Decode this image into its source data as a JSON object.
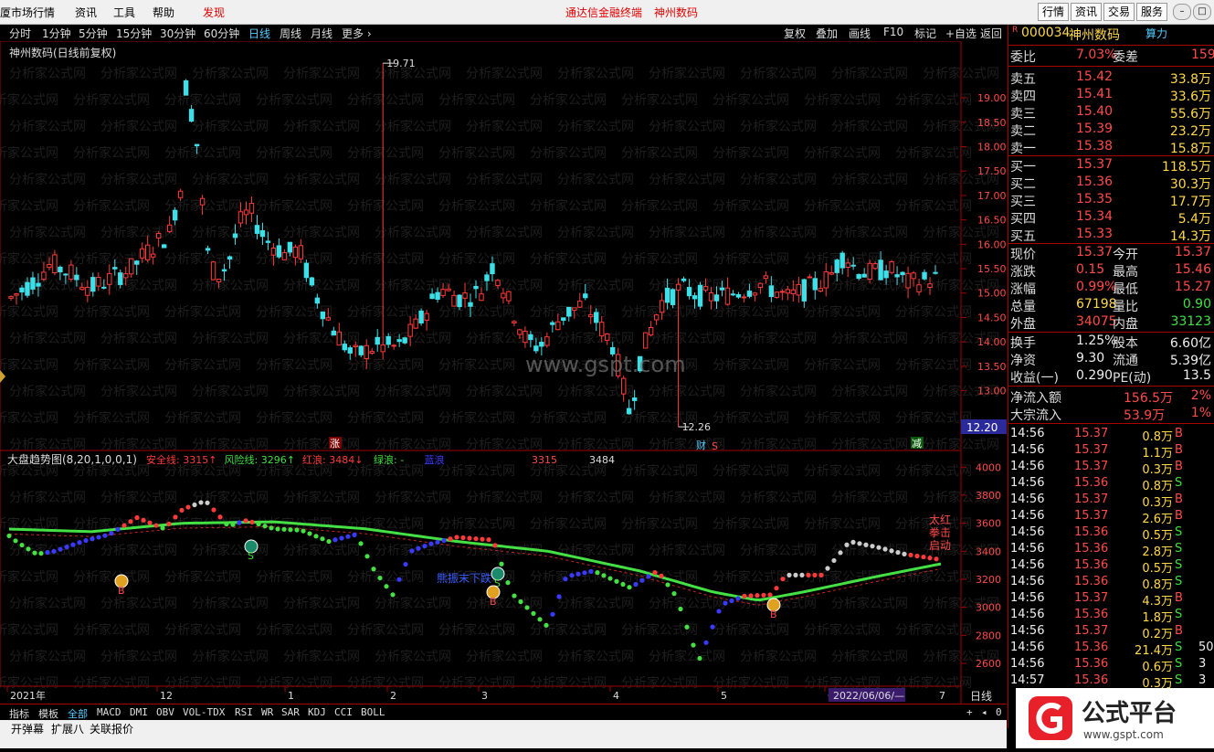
{
  "menu": {
    "items": [
      "厦市场行情",
      "资讯",
      "工具",
      "帮助"
    ],
    "discover": "发现",
    "center_title": "通达信金融终端",
    "center_stock": "神州数码",
    "right_buttons": [
      "行情",
      "资讯",
      "交易",
      "服务"
    ]
  },
  "timeframes": [
    "分时",
    "1分钟",
    "5分钟",
    "15分钟",
    "30分钟",
    "60分钟",
    "日线",
    "周线",
    "月线",
    "更多 ›"
  ],
  "active_timeframe": "日线",
  "chart_tools": [
    "复权",
    "叠加",
    "画线",
    "F10",
    "标记",
    "+自选",
    "返回"
  ],
  "main_chart": {
    "title": "神州数码(日线前复权)",
    "high_label": "19.71",
    "low_label": "12.26",
    "current_price_tag": "12.20",
    "y_ticks": [
      19.0,
      18.5,
      18.0,
      17.5,
      17.0,
      16.5,
      16.0,
      15.5,
      15.0,
      14.5,
      14.0,
      13.5,
      13.0
    ],
    "watermark": "www.gspt.com",
    "bg_watermark": "分析家公式网",
    "markers": {
      "zhang": "涨",
      "cai": "财",
      "s": "S",
      "jian": "减"
    },
    "colors": {
      "up": "#ff3a3a",
      "down": "#3de0e8",
      "axis": "#a00000"
    }
  },
  "indicator": {
    "title": "大盘趋势图(8,20,1,0,0,1)",
    "legend": [
      {
        "label": "安全线: 3315",
        "arrow": "↑",
        "color": "#ff3a3a"
      },
      {
        "label": "风险线: 3296",
        "arrow": "↑",
        "color": "#3fe03f"
      },
      {
        "label": "红浪: 3484",
        "arrow": "↓",
        "color": "#ff3a3a"
      },
      {
        "label": "绿浪: -",
        "arrow": "",
        "color": "#3fe03f"
      },
      {
        "label": "蓝浪",
        "arrow": "",
        "color": "#3a3aff"
      }
    ],
    "extra_values": [
      "3315",
      "3484"
    ],
    "y_ticks": [
      4000,
      3800,
      3600,
      3400,
      3200,
      3000,
      2800,
      2600
    ],
    "note": "熊振末下跌",
    "right_text": [
      "太红",
      "拳击",
      "启动"
    ],
    "signals": {
      "b": "B",
      "s": "S"
    }
  },
  "x_axis": {
    "labels": [
      "2021年",
      "12",
      "1",
      "2",
      "3",
      "4",
      "5",
      "6"
    ],
    "date_label": "2022/06/06/—",
    "last_label": "7",
    "period": "日线"
  },
  "bottom_tabs": [
    "指标",
    "模板",
    "全部",
    "MACD",
    "DMI",
    "OBV",
    "VOL-TDX",
    "RSI",
    "WR",
    "SAR",
    "KDJ",
    "CCI",
    "BOLL"
  ],
  "active_tab": "全部",
  "bottom_tabs2": [
    "开弹幕",
    "扩展八",
    "关联报价"
  ],
  "quote": {
    "marker": "R",
    "code": "000034",
    "name": "神州数码",
    "suanli": "算力",
    "weibi_label": "委比",
    "weibi": "7.03%",
    "weicha_label": "委差",
    "weicha": "159",
    "sell": [
      {
        "label": "卖五",
        "price": "15.42",
        "vol": "33.8万"
      },
      {
        "label": "卖四",
        "price": "15.41",
        "vol": "33.6万"
      },
      {
        "label": "卖三",
        "price": "15.40",
        "vol": "55.6万"
      },
      {
        "label": "卖二",
        "price": "15.39",
        "vol": "23.2万"
      },
      {
        "label": "卖一",
        "price": "15.38",
        "vol": "15.8万"
      }
    ],
    "buy": [
      {
        "label": "买一",
        "price": "15.37",
        "vol": "118.5万"
      },
      {
        "label": "买二",
        "price": "15.36",
        "vol": "30.3万"
      },
      {
        "label": "买三",
        "price": "15.35",
        "vol": "17.7万"
      },
      {
        "label": "买四",
        "price": "15.34",
        "vol": "5.4万"
      },
      {
        "label": "买五",
        "price": "15.33",
        "vol": "14.3万"
      }
    ],
    "stats": [
      {
        "l1": "现价",
        "v1": "15.37",
        "c1": "up",
        "l2": "今开",
        "v2": "15.37",
        "c2": "up"
      },
      {
        "l1": "涨跌",
        "v1": "0.15",
        "c1": "up",
        "l2": "最高",
        "v2": "15.46",
        "c2": "up"
      },
      {
        "l1": "涨幅",
        "v1": "0.99%",
        "c1": "up",
        "l2": "最低",
        "v2": "15.27",
        "c2": "up"
      },
      {
        "l1": "总量",
        "v1": "67198",
        "c1": "yel",
        "l2": "量比",
        "v2": "0.90",
        "c2": "dn"
      },
      {
        "l1": "外盘",
        "v1": "34075",
        "c1": "up",
        "l2": "内盘",
        "v2": "33123",
        "c2": "dn"
      }
    ],
    "stats2": [
      {
        "l1": "换手",
        "v1": "1.25%",
        "l2": "股本",
        "v2": "6.60亿"
      },
      {
        "l1": "净资",
        "v1": "9.30",
        "l2": "流通",
        "v2": "5.39亿"
      },
      {
        "l1": "收益(一)",
        "v1": "0.290",
        "l2": "PE(动)",
        "v2": "13.5"
      }
    ],
    "flow": [
      {
        "label": "净流入额",
        "value": "156.5万",
        "pct": "2%"
      },
      {
        "label": "大宗流入",
        "value": "53.9万",
        "pct": "1%"
      }
    ],
    "ticks": [
      {
        "t": "14:56",
        "p": "15.37",
        "v": "0.8万",
        "s": "B"
      },
      {
        "t": "14:56",
        "p": "15.37",
        "v": "1.1万",
        "s": "B"
      },
      {
        "t": "14:56",
        "p": "15.37",
        "v": "0.3万",
        "s": "B"
      },
      {
        "t": "14:56",
        "p": "15.36",
        "v": "0.8万",
        "s": "S"
      },
      {
        "t": "14:56",
        "p": "15.37",
        "v": "0.3万",
        "s": "B"
      },
      {
        "t": "14:56",
        "p": "15.37",
        "v": "2.6万",
        "s": "B"
      },
      {
        "t": "14:56",
        "p": "15.36",
        "v": "0.5万",
        "s": "S"
      },
      {
        "t": "14:56",
        "p": "15.36",
        "v": "2.8万",
        "s": "S"
      },
      {
        "t": "14:56",
        "p": "15.36",
        "v": "0.5万",
        "s": "S"
      },
      {
        "t": "14:56",
        "p": "15.36",
        "v": "0.8万",
        "s": "S"
      },
      {
        "t": "14:56",
        "p": "15.37",
        "v": "4.3万",
        "s": "B"
      },
      {
        "t": "14:56",
        "p": "15.36",
        "v": "1.8万",
        "s": "S"
      },
      {
        "t": "14:56",
        "p": "15.37",
        "v": "0.2万",
        "s": "B"
      },
      {
        "t": "14:56",
        "p": "15.36",
        "v": "21.4万",
        "s": "S",
        "n": "50"
      },
      {
        "t": "14:56",
        "p": "15.36",
        "v": "0.6万",
        "s": "S",
        "n": "3"
      },
      {
        "t": "14:57",
        "p": "15.36",
        "v": "0.3万",
        "s": "S",
        "n": "3"
      }
    ]
  },
  "logo": {
    "text": "公式平台",
    "url": "www.gspt.com"
  }
}
